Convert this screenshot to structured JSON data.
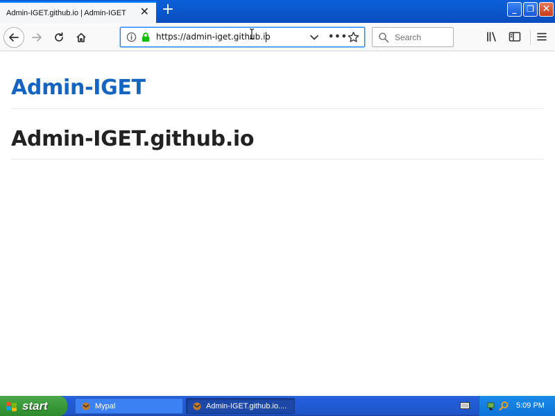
{
  "browser": {
    "tab_title": "Admin-IGET.github.io | Admin-IGET",
    "url": "https://admin-iget.github.io",
    "search_placeholder": "Search",
    "icons": [
      "back-arrow-icon",
      "forward-arrow-icon",
      "reload-icon",
      "home-icon",
      "info-icon",
      "lock-icon",
      "chevron-down-icon",
      "more-icon",
      "star-icon",
      "search-icon",
      "library-icon",
      "sidebar-icon",
      "hamburger-menu-icon",
      "close-icon",
      "plus-icon"
    ]
  },
  "page": {
    "site_title": "Admin-IGET",
    "heading": "Admin-IGET.github.io"
  },
  "taskbar": {
    "start_label": "start",
    "tasks": [
      {
        "label": "Mypal"
      },
      {
        "label": "Admin-IGET.github.io...."
      }
    ],
    "clock": "5:09 PM"
  },
  "colors": {
    "title_blue": "#1565c0",
    "heading_text": "#222222",
    "url_focus": "#0a84ff",
    "taskbar_blue": "#245edc",
    "start_green": "#3a9a3a"
  }
}
